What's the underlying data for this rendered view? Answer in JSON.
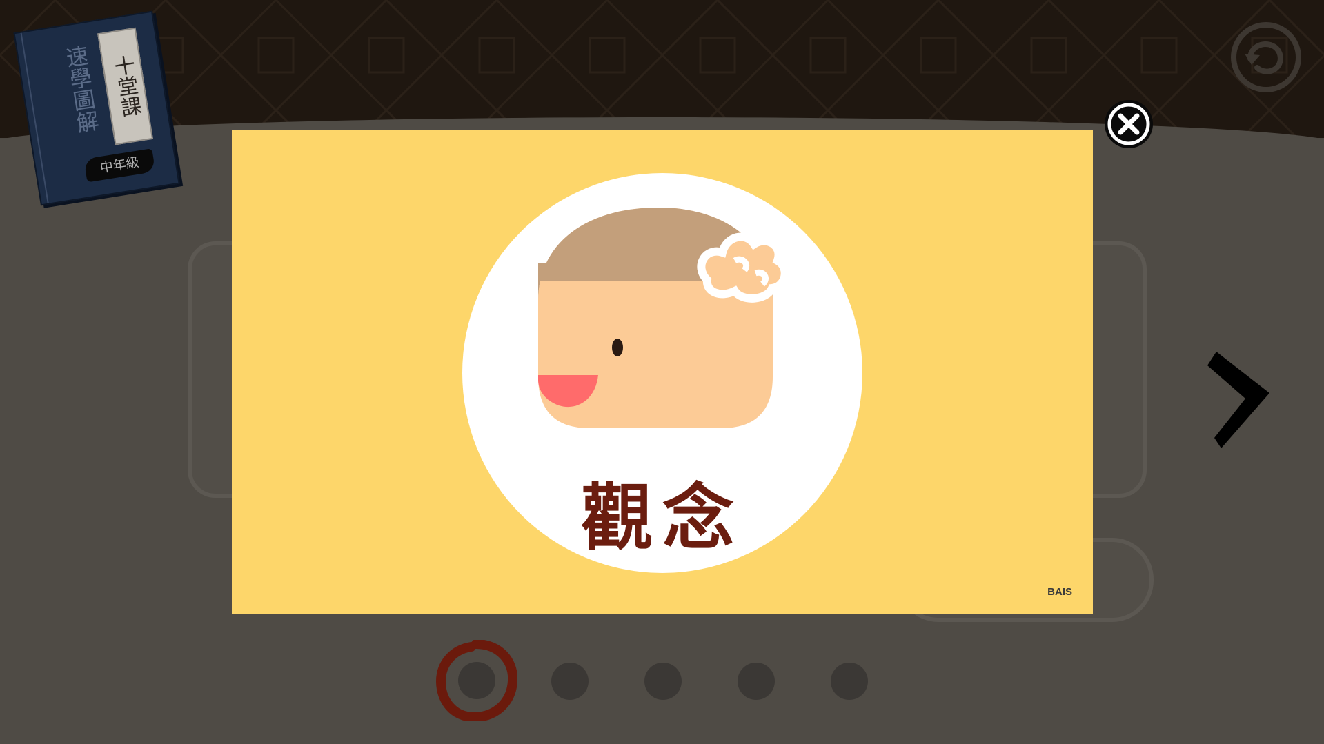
{
  "book": {
    "title": "十堂課",
    "subtitle": "速學圖解",
    "grade": "中年級"
  },
  "modal": {
    "label": "觀念",
    "credit": "BAIS",
    "background_color": "#fdd66a",
    "label_color": "#6b1d0f"
  },
  "navigation": {
    "back_icon": "back-arrow-icon",
    "next_icon": "chevron-right-icon",
    "close_icon": "close-icon"
  },
  "pagination": {
    "total_pages": 5,
    "current_page": 1
  }
}
